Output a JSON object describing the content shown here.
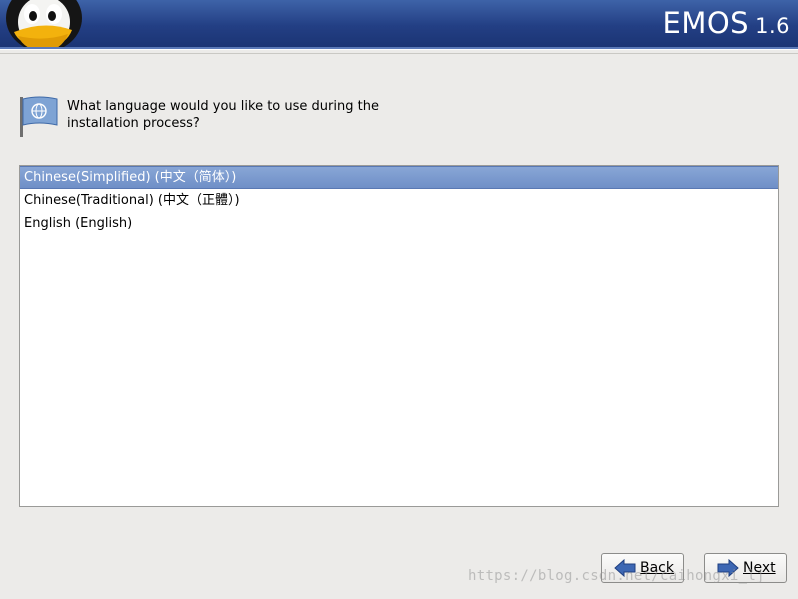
{
  "header": {
    "brand_name": "EMOS",
    "brand_version": "1.6",
    "logo_icon": "tux-penguin-icon",
    "accent_color": "#233f84"
  },
  "prompt": {
    "icon": "language-flag-icon",
    "text": "What language would you like to use during the\ninstallation process?"
  },
  "languages": {
    "items": [
      {
        "label": "Chinese(Simplified) (中文（简体）)",
        "selected": true
      },
      {
        "label": "Chinese(Traditional) (中文（正體）)",
        "selected": false
      },
      {
        "label": "English (English)",
        "selected": false
      }
    ],
    "selection_color": "#7595cc"
  },
  "buttons": {
    "back": {
      "label": "Back",
      "icon": "arrow-left-icon"
    },
    "next": {
      "label": "Next",
      "icon": "arrow-right-icon"
    }
  },
  "watermark": "https://blog.csdn.net/caihongxi_lj"
}
